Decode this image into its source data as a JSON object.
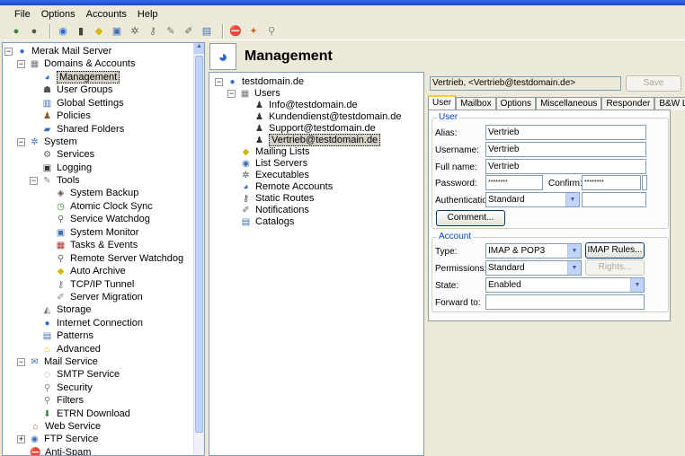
{
  "menu": [
    "File",
    "Options",
    "Accounts",
    "Help"
  ],
  "toolbar_icons": [
    "globe-icon",
    "globe-dark-icon",
    "server-icon",
    "lock-icon",
    "diamond-icon",
    "monitor-icon",
    "gear-icon",
    "key-icon",
    "tools-icon",
    "pencil-icon",
    "book-icon",
    "stop-icon",
    "run-icon",
    "magnifier-icon"
  ],
  "left_tree": {
    "root": "Merak Mail Server",
    "items": [
      {
        "label": "Domains & Accounts"
      },
      {
        "label": "Management"
      },
      {
        "label": "User Groups"
      },
      {
        "label": "Global Settings"
      },
      {
        "label": "Policies"
      },
      {
        "label": "Shared Folders"
      },
      {
        "label": "System"
      },
      {
        "label": "Services"
      },
      {
        "label": "Logging"
      },
      {
        "label": "Tools"
      },
      {
        "label": "System Backup"
      },
      {
        "label": "Atomic Clock Sync"
      },
      {
        "label": "Service Watchdog"
      },
      {
        "label": "System Monitor"
      },
      {
        "label": "Tasks & Events"
      },
      {
        "label": "Remote Server Watchdog"
      },
      {
        "label": "Auto Archive"
      },
      {
        "label": "TCP/IP Tunnel"
      },
      {
        "label": "Server Migration"
      },
      {
        "label": "Storage"
      },
      {
        "label": "Internet Connection"
      },
      {
        "label": "Patterns"
      },
      {
        "label": "Advanced"
      },
      {
        "label": "Mail Service"
      },
      {
        "label": "SMTP Service"
      },
      {
        "label": "Security"
      },
      {
        "label": "Filters"
      },
      {
        "label": "ETRN Download"
      },
      {
        "label": "Web Service"
      },
      {
        "label": "FTP Service"
      },
      {
        "label": "Anti-Spam"
      }
    ]
  },
  "header": {
    "title": "Management"
  },
  "mid_tree": {
    "domain": "testdomain.de",
    "users_label": "Users",
    "users": [
      "Info@testdomain.de",
      "Kundendienst@testdomain.de",
      "Support@testdomain.de",
      "Vertrieb@testdomain.de"
    ],
    "other": [
      "Mailing Lists",
      "List Servers",
      "Executables",
      "Remote Accounts",
      "Static Routes",
      "Notifications",
      "Catalogs"
    ]
  },
  "account": {
    "name_display": "Vertrieb, <Vertrieb@testdomain.de>",
    "save_label": "Save",
    "tabs": [
      "User",
      "Mailbox",
      "Options",
      "Miscellaneous",
      "Responder",
      "B&W List"
    ],
    "user_group": "User",
    "alias_label": "Alias:",
    "alias": "Vertrieb",
    "username_label": "Username:",
    "username": "Vertrieb",
    "fullname_label": "Full name:",
    "fullname": "Vertrieb",
    "password_label": "Password:",
    "password": "********",
    "confirm_label": "Confirm:",
    "confirm": "********",
    "auth_label": "Authentication:",
    "auth": "Standard",
    "comment_btn": "Comment...",
    "account_group": "Account",
    "type_label": "Type:",
    "type": "IMAP & POP3",
    "imap_rules_btn": "IMAP Rules...",
    "perm_label": "Permissions:",
    "permissions": "Standard",
    "rights_btn": "Rights...",
    "state_label": "State:",
    "state": "Enabled",
    "forward_label": "Forward to:",
    "forward": ""
  }
}
